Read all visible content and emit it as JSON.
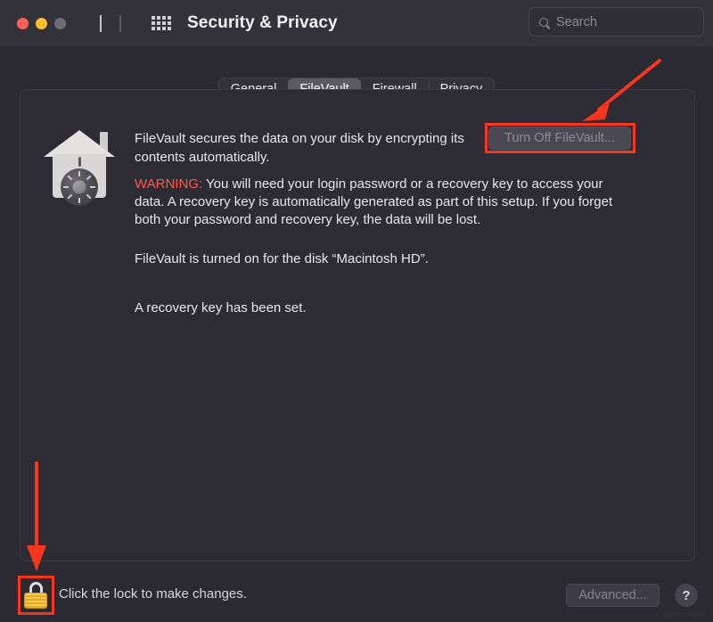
{
  "window": {
    "title": "Security & Privacy",
    "traffic_lights": [
      "close",
      "minimize",
      "zoom"
    ],
    "colors": {
      "close": "#ff5f57",
      "minimize": "#febc2e",
      "zoom": "#6e6d75",
      "accent_annotation": "#f8351d",
      "warning_text": "#ff5a4e",
      "titlebar_bg": "#333139",
      "window_bg": "#2b2a33",
      "panel_bg": "#2d2b34"
    }
  },
  "toolbar": {
    "back_icon": "chevron-left-icon",
    "forward_icon": "chevron-right-icon",
    "grid_icon": "app-grid-icon",
    "search": {
      "placeholder": "Search",
      "value": "",
      "icon": "search-icon"
    }
  },
  "tabs": [
    {
      "label": "General",
      "active": false
    },
    {
      "label": "FileVault",
      "active": true
    },
    {
      "label": "Firewall",
      "active": false
    },
    {
      "label": "Privacy",
      "active": false
    }
  ],
  "filevault": {
    "icon_name": "filevault-house-vault-icon",
    "intro": "FileVault secures the data on your disk by encrypting its contents automatically.",
    "warning_label": "WARNING:",
    "warning_body": " You will need your login password or a recovery key to access your data. A recovery key is automatically generated as part of this setup. If you forget both your password and recovery key, the data will be lost.",
    "disk_status": "FileVault is turned on for the disk “Macintosh HD”.",
    "recovery_status": "A recovery key has been set.",
    "turn_off_button": "Turn Off FileVault...",
    "turn_off_disabled": true
  },
  "footer": {
    "lock_icon": "padlock-locked-icon",
    "lock_text": "Click the lock to make changes.",
    "advanced_button": "Advanced...",
    "advanced_disabled": true,
    "help_button": "?"
  },
  "annotations": {
    "arrow_to_turnoff": "red-arrow-pointing-to-turn-off-filevault-button",
    "arrow_to_lock": "red-arrow-pointing-to-lock-icon",
    "box_turnoff": "red-highlight-box-turn-off-filevault",
    "box_lock": "red-highlight-box-lock-icon"
  },
  "watermark": "wxcdn.com"
}
